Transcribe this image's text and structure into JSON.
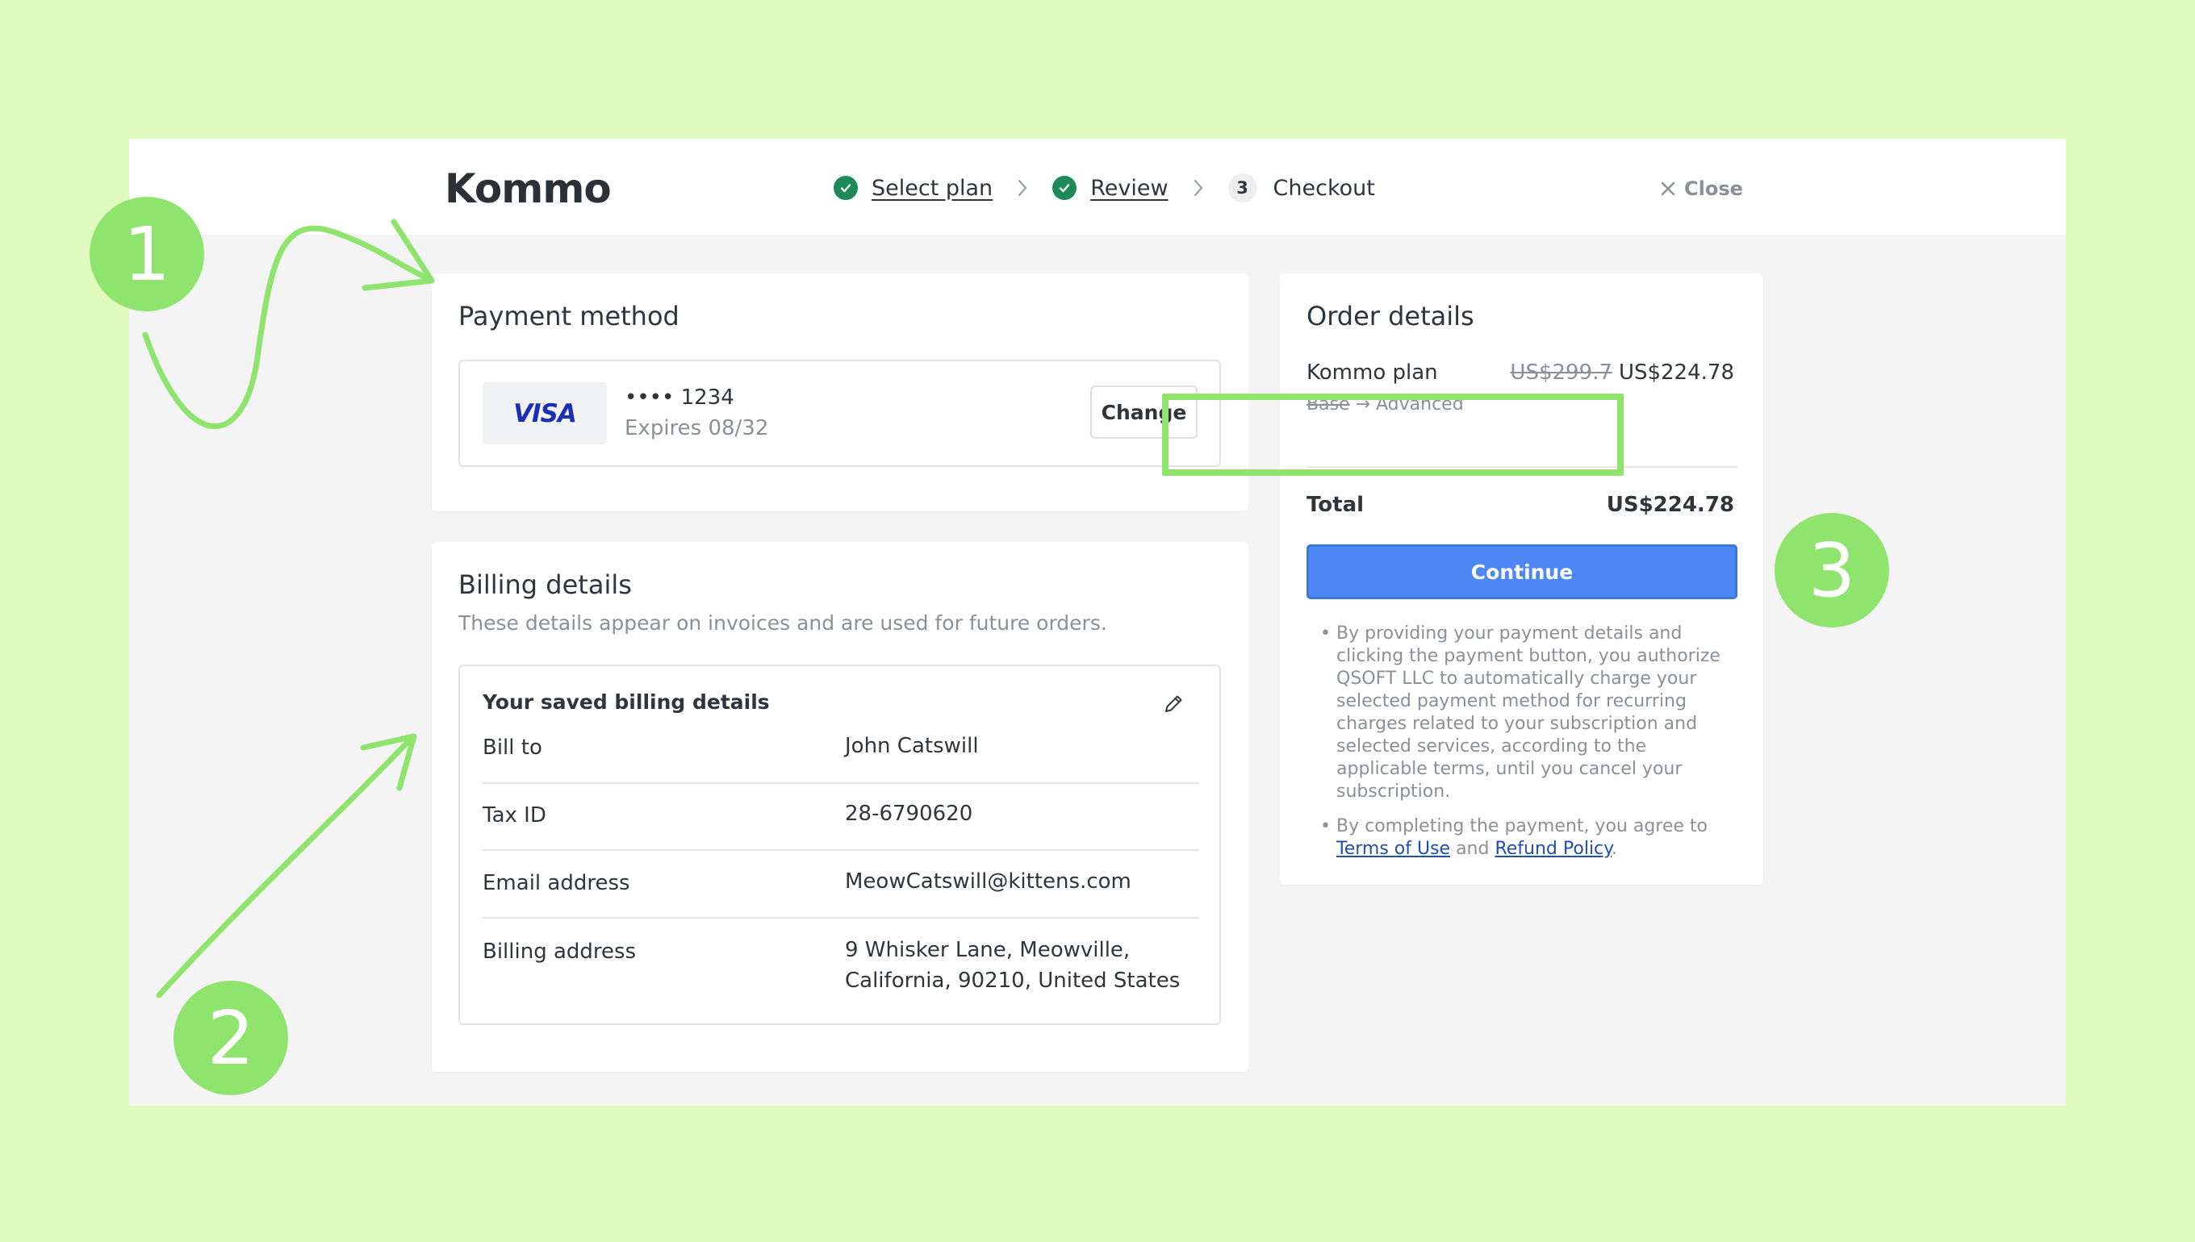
{
  "header": {
    "logo_text": "Kommo",
    "close_label": "Close",
    "steps": [
      {
        "label": "Select plan",
        "state": "done"
      },
      {
        "label": "Review",
        "state": "done"
      },
      {
        "label": "Checkout",
        "state": "current",
        "number": "3"
      }
    ]
  },
  "payment": {
    "title": "Payment method",
    "brand": "VISA",
    "card_number": "•••• 1234",
    "expires": "Expires 08/32",
    "change_label": "Change"
  },
  "billing": {
    "title": "Billing details",
    "subtitle": "These details appear on invoices and are used for future orders.",
    "saved_heading": "Your saved billing details",
    "rows": [
      {
        "label": "Bill to",
        "value": "John Catswill"
      },
      {
        "label": "Tax ID",
        "value": "28-6790620"
      },
      {
        "label": "Email address",
        "value": "MeowCatswill@kittens.com"
      },
      {
        "label": "Billing address",
        "value_line1": "9 Whisker Lane, Meowville,",
        "value_line2": "California, 90210, United States"
      }
    ]
  },
  "order": {
    "title": "Order details",
    "plan_name": "Kommo plan",
    "old_price": "US$299.7",
    "new_price": "US$224.78",
    "from_plan": "Base",
    "arrow": "→",
    "to_plan": "Advanced",
    "total_label": "Total",
    "total_value": "US$224.78",
    "continue_label": "Continue",
    "note1": "By providing your payment details and clicking the payment button, you authorize QSOFT LLC to automatically charge your selected payment method for recurring charges related to your subscription and selected services, according to the applicable terms, until you cancel your subscription.",
    "note2_prefix": "By completing the payment, you agree to ",
    "terms_link": "Terms of Use",
    "note2_and": " and ",
    "refund_link": "Refund Policy",
    "note2_suffix": "."
  },
  "annotations": {
    "badge1": "1",
    "badge2": "2",
    "badge3": "3",
    "highlight_color": "#8ee46d"
  },
  "colors": {
    "background": "#e0fbbd",
    "accent_blue": "#4e88f4",
    "check_green": "#1e8a5a"
  }
}
